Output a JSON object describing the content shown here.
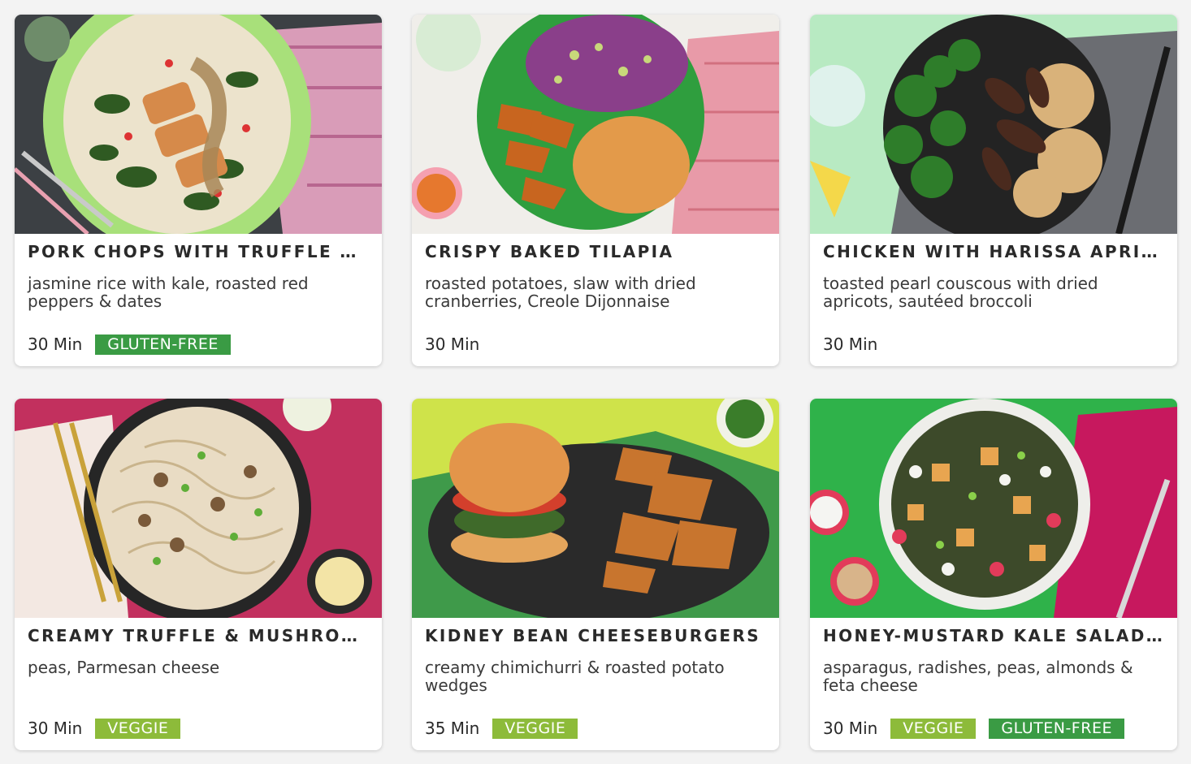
{
  "colors": {
    "gluten_free": "#3a9b44",
    "veggie": "#8dbb3a"
  },
  "recipes": [
    {
      "name": "PORK CHOPS WITH TRUFFLE ROASTED RED PEPPER SAUCE",
      "description": "jasmine rice with kale, roasted red peppers & dates",
      "time": "30 Min",
      "tags": [
        "GLUTEN-FREE"
      ],
      "image": "pork-chops-dish"
    },
    {
      "name": "CRISPY BAKED TILAPIA",
      "description": "roasted potatoes, slaw with dried cranberries, Creole Dijonnaise",
      "time": "30 Min",
      "tags": [],
      "image": "tilapia-dish"
    },
    {
      "name": "CHICKEN WITH HARISSA APRICOT SAUCE",
      "description": "toasted pearl couscous with dried apricots, sautéed broccoli",
      "time": "30 Min",
      "tags": [],
      "image": "chicken-couscous-dish"
    },
    {
      "name": "CREAMY TRUFFLE & MUSHROOM PASTA",
      "description": "peas, Parmesan cheese",
      "time": "30 Min",
      "tags": [
        "VEGGIE"
      ],
      "image": "mushroom-pasta-dish"
    },
    {
      "name": "KIDNEY BEAN CHEESEBURGERS",
      "description": "creamy chimichurri & roasted potato wedges",
      "time": "35 Min",
      "tags": [
        "VEGGIE"
      ],
      "image": "cheeseburger-dish"
    },
    {
      "name": "HONEY-MUSTARD KALE SALAD WITH CRISPY TOFU",
      "description": "asparagus, radishes, peas, almonds & feta cheese",
      "time": "30 Min",
      "tags": [
        "VEGGIE",
        "GLUTEN-FREE"
      ],
      "image": "kale-salad-dish"
    }
  ]
}
